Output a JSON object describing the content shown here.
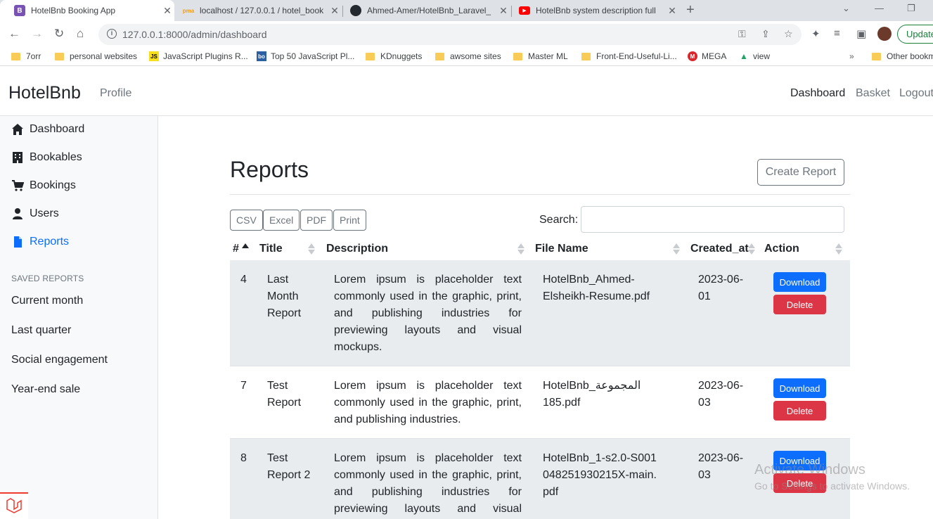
{
  "browser": {
    "tabs": [
      {
        "title": "HotelBnb Booking App",
        "favicon": "B",
        "favicon_color": "#7952b3",
        "active": true
      },
      {
        "title": "localhost / 127.0.0.1 / hotel_book",
        "favicon": "pma",
        "favicon_color": "#f89c0e",
        "active": false
      },
      {
        "title": "Ahmed-Amer/HotelBnb_Laravel_",
        "favicon": "github",
        "favicon_color": "#24292f",
        "active": false
      },
      {
        "title": "HotelBnb system description full",
        "favicon": "youtube",
        "favicon_color": "#ff0000",
        "active": false
      }
    ],
    "url": "127.0.0.1:8000/admin/dashboard",
    "update_label": "Update",
    "bookmarks": [
      {
        "label": "7orr",
        "icon": "folder"
      },
      {
        "label": "personal websites",
        "icon": "folder"
      },
      {
        "label": "JavaScript Plugins R...",
        "icon": "js"
      },
      {
        "label": "Top 50 JavaScript Pl...",
        "icon": "bo"
      },
      {
        "label": "KDnuggets",
        "icon": "folder"
      },
      {
        "label": "awsome sites",
        "icon": "folder"
      },
      {
        "label": "Master ML",
        "icon": "folder"
      },
      {
        "label": "Front-End-Useful-Li...",
        "icon": "folder"
      },
      {
        "label": "MEGA",
        "icon": "mega"
      },
      {
        "label": "view",
        "icon": "drive"
      }
    ],
    "other_bookmarks": "Other bookm"
  },
  "navbar": {
    "brand": "HotelBnb",
    "profile": "Profile",
    "dashboard": "Dashboard",
    "basket": "Basket",
    "logout": "Logout"
  },
  "sidebar": {
    "items": [
      {
        "label": "Dashboard",
        "icon": "home-icon"
      },
      {
        "label": "Bookables",
        "icon": "building-icon"
      },
      {
        "label": "Bookings",
        "icon": "cart-icon"
      },
      {
        "label": "Users",
        "icon": "user-icon"
      },
      {
        "label": "Reports",
        "icon": "file-icon",
        "active": true
      }
    ],
    "saved_heading": "SAVED REPORTS",
    "saved": [
      "Current month",
      "Last quarter",
      "Social engagement",
      "Year-end sale"
    ]
  },
  "main": {
    "title": "Reports",
    "create_label": "Create Report",
    "export_buttons": [
      "CSV",
      "Excel",
      "PDF",
      "Print"
    ],
    "search_label": "Search:",
    "columns": [
      "#",
      "Title",
      "Description",
      "File Name",
      "Created_at",
      "Action"
    ],
    "download_label": "Download",
    "delete_label": "Delete",
    "rows": [
      {
        "id": "4",
        "title": "Last Month Report",
        "description": "Lorem ipsum is placeholder text commonly used in the graphic, print, and publishing industries for previewing layouts and visual mockups.",
        "file": "HotelBnb_Ahmed-Elsheikh-Resume.pdf",
        "created": "2023-06-01"
      },
      {
        "id": "7",
        "title": "Test Report",
        "description": "Lorem ipsum is placeholder text commonly used in the graphic, print, and publishing industries.",
        "file": "HotelBnb_المجموعة 185.pdf",
        "created": "2023-06-03"
      },
      {
        "id": "8",
        "title": "Test Report 2",
        "description": "Lorem ipsum is placeholder text commonly used in the graphic, print, and publishing industries for previewing layouts and visual mockups.",
        "file": "HotelBnb_1-s2.0-S001048251930215X-main.pdf",
        "created": "2023-06-03"
      }
    ]
  },
  "watermark": {
    "line1": "Activate Windows",
    "line2": "Go to Settings to activate Windows."
  }
}
